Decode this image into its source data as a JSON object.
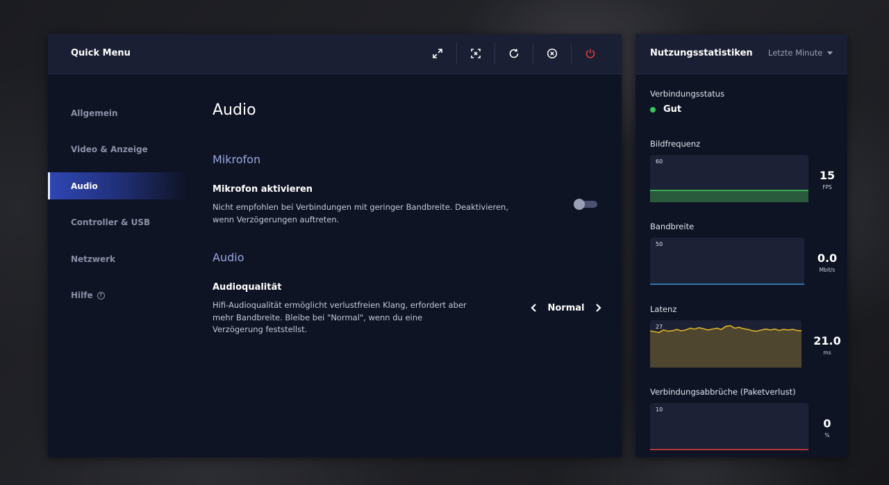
{
  "quick_menu": {
    "title": "Quick Menu",
    "tools": [
      "expand-icon",
      "screenshot-icon",
      "refresh-icon",
      "close-circle-icon",
      "power-icon"
    ]
  },
  "nav": {
    "items": [
      {
        "label": "Allgemein"
      },
      {
        "label": "Video & Anzeige"
      },
      {
        "label": "Audio",
        "active": true
      },
      {
        "label": "Controller & USB"
      },
      {
        "label": "Netzwerk"
      },
      {
        "label": "Hilfe"
      }
    ]
  },
  "content": {
    "page_title": "Audio",
    "mic_section": "Mikrofon",
    "mic_setting": {
      "title": "Mikrofon aktivieren",
      "desc_line1": "Nicht empfohlen bei Verbindungen mit geringer Bandbreite. Deaktivieren,",
      "desc_line2": "wenn Verzögerungen auftreten.",
      "enabled": false
    },
    "audio_section": "Audio",
    "quality_setting": {
      "title": "Audioqualität",
      "desc_line1": "Hifi-Audioqualität ermöglicht verlustfreien Klang, erfordert aber",
      "desc_line2": "mehr Bandbreite. Bleibe bei \"Normal\", wenn du eine",
      "desc_line3": "Verzögerung feststellst.",
      "value": "Normal"
    }
  },
  "stats": {
    "title": "Nutzungsstatistiken",
    "range": "Letzte Minute",
    "connection": {
      "label": "Verbindungsstatus",
      "value": "Gut",
      "color": "#35c85a"
    },
    "fps": {
      "label": "Bildfrequenz",
      "max": "60",
      "value": "15",
      "unit": "FPS",
      "color": "#3fcf5a"
    },
    "bandwidth": {
      "label": "Bandbreite",
      "max": "50",
      "value": "0.0",
      "unit": "Mbit/s",
      "color": "#3a8fd0"
    },
    "latency": {
      "label": "Latenz",
      "max": "27",
      "value": "21.0",
      "unit": "ms",
      "color": "#e0b428"
    },
    "packet_loss": {
      "label": "Verbindungsabbrüche (Paketverlust)",
      "max": "10",
      "value": "0",
      "unit": "%",
      "color": "#e04040"
    }
  },
  "chart_data": [
    {
      "type": "area",
      "title": "Bildfrequenz",
      "ylim": [
        0,
        60
      ],
      "values": [
        15,
        15,
        15,
        15,
        15,
        15,
        15,
        15,
        15,
        15,
        15,
        15,
        15,
        15,
        15,
        15,
        15,
        15,
        15,
        15,
        15,
        15,
        15,
        15,
        15,
        15,
        15,
        15,
        15,
        15
      ]
    },
    {
      "type": "area",
      "title": "Bandbreite",
      "ylim": [
        0,
        50
      ],
      "values": [
        0,
        0,
        0,
        0,
        0,
        0,
        0,
        0,
        0,
        0,
        0,
        0,
        0,
        0,
        0,
        0,
        0,
        0,
        0,
        0,
        0,
        0,
        0,
        0,
        0,
        0,
        0,
        0,
        0,
        0
      ]
    },
    {
      "type": "area",
      "title": "Latenz",
      "ylim": [
        0,
        27
      ],
      "values": [
        21,
        20.5,
        20,
        21.5,
        20.8,
        21,
        21.8,
        21,
        21.5,
        22.5,
        22,
        22.8,
        22.2,
        21.5,
        22,
        22.5,
        21.8,
        23.5,
        24,
        22.5,
        23,
        22.2,
        21.8,
        21,
        20.8,
        21.5,
        22,
        21.5,
        22,
        21.2,
        21.8,
        21.5,
        21.8,
        21.2,
        21
      ]
    },
    {
      "type": "area",
      "title": "Verbindungsabbrüche (Paketverlust)",
      "ylim": [
        0,
        10
      ],
      "values": [
        0,
        0,
        0,
        0,
        0,
        0,
        0,
        0,
        0,
        0,
        0,
        0,
        0,
        0,
        0,
        0,
        0,
        0,
        0,
        0,
        0,
        0,
        0,
        0,
        0,
        0,
        0,
        0,
        0,
        0
      ]
    }
  ]
}
